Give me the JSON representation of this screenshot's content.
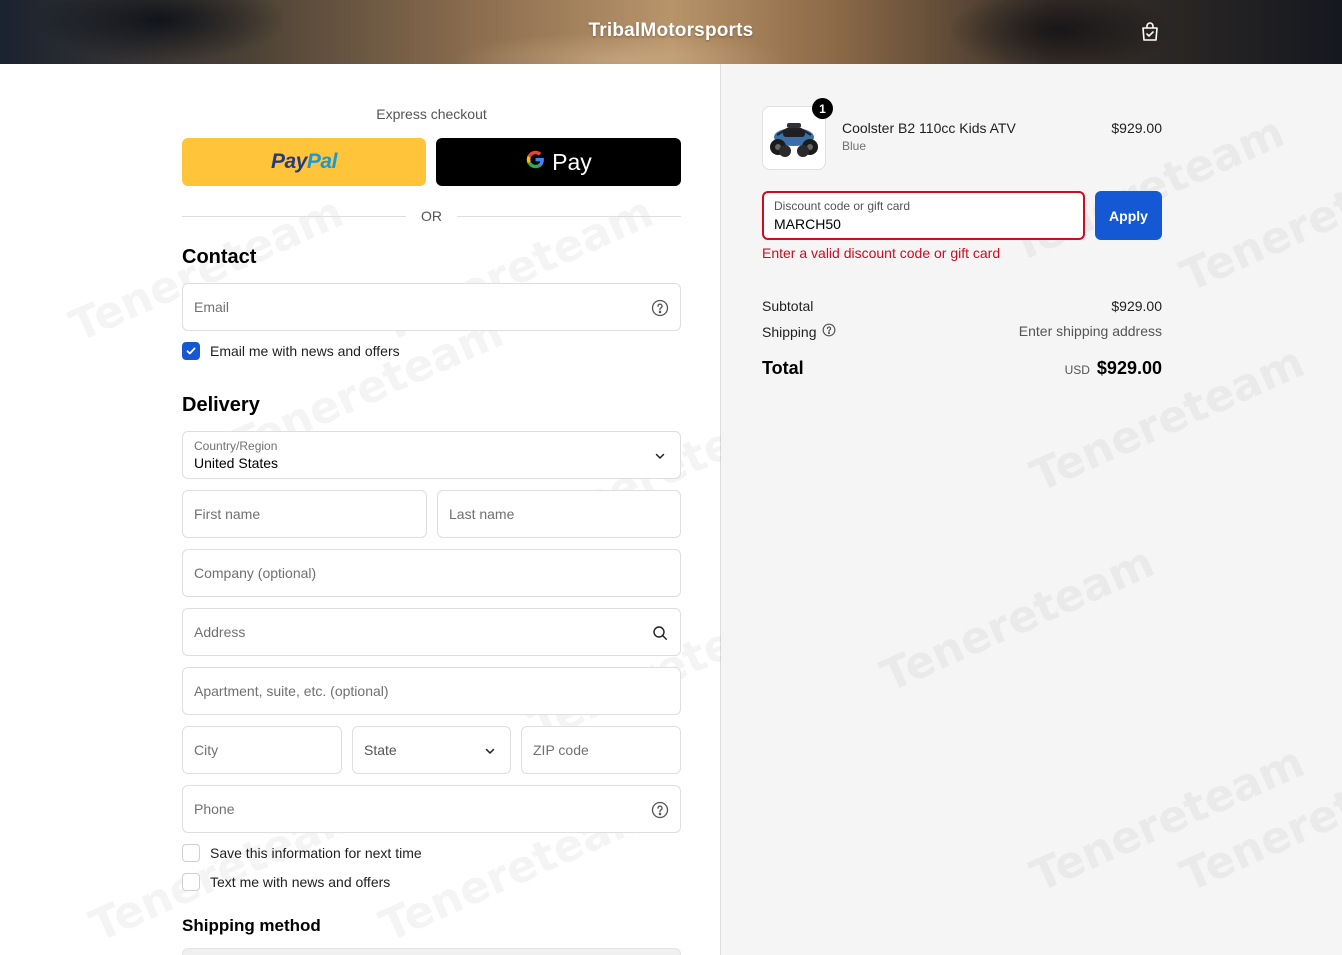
{
  "header": {
    "brand": "TribalMotorsports",
    "cart_icon": "bag-icon"
  },
  "express": {
    "label": "Express checkout",
    "paypal_part1": "Pay",
    "paypal_part2": "Pal",
    "gpay_label": "Pay",
    "or_label": "OR"
  },
  "contact": {
    "title": "Contact",
    "email_placeholder": "Email",
    "newsletter_label": "Email me with news and offers",
    "newsletter_checked": true
  },
  "delivery": {
    "title": "Delivery",
    "country_label": "Country/Region",
    "country_value": "United States",
    "first_name": "First name",
    "last_name": "Last name",
    "company": "Company (optional)",
    "address": "Address",
    "apartment": "Apartment, suite, etc. (optional)",
    "city": "City",
    "state": "State",
    "zip": "ZIP code",
    "phone": "Phone",
    "save_info_label": "Save this information for next time",
    "text_offers_label": "Text me with news and offers"
  },
  "shipping_method": {
    "title": "Shipping method"
  },
  "summary": {
    "product": {
      "name": "Coolster B2 110cc Kids ATV",
      "variant": "Blue",
      "price": "$929.00",
      "quantity": "1"
    },
    "discount": {
      "label": "Discount code or gift card",
      "value": "MARCH50",
      "apply_label": "Apply",
      "error": "Enter a valid discount code or gift card"
    },
    "subtotal_label": "Subtotal",
    "subtotal_value": "$929.00",
    "shipping_label": "Shipping",
    "shipping_value": "Enter shipping address",
    "total_label": "Total",
    "currency": "USD",
    "total_value": "$929.00"
  },
  "colors": {
    "accent": "#1458d4",
    "error": "#d00a1f",
    "paypal_yellow": "#ffc439"
  },
  "watermark": "Tenereteam"
}
